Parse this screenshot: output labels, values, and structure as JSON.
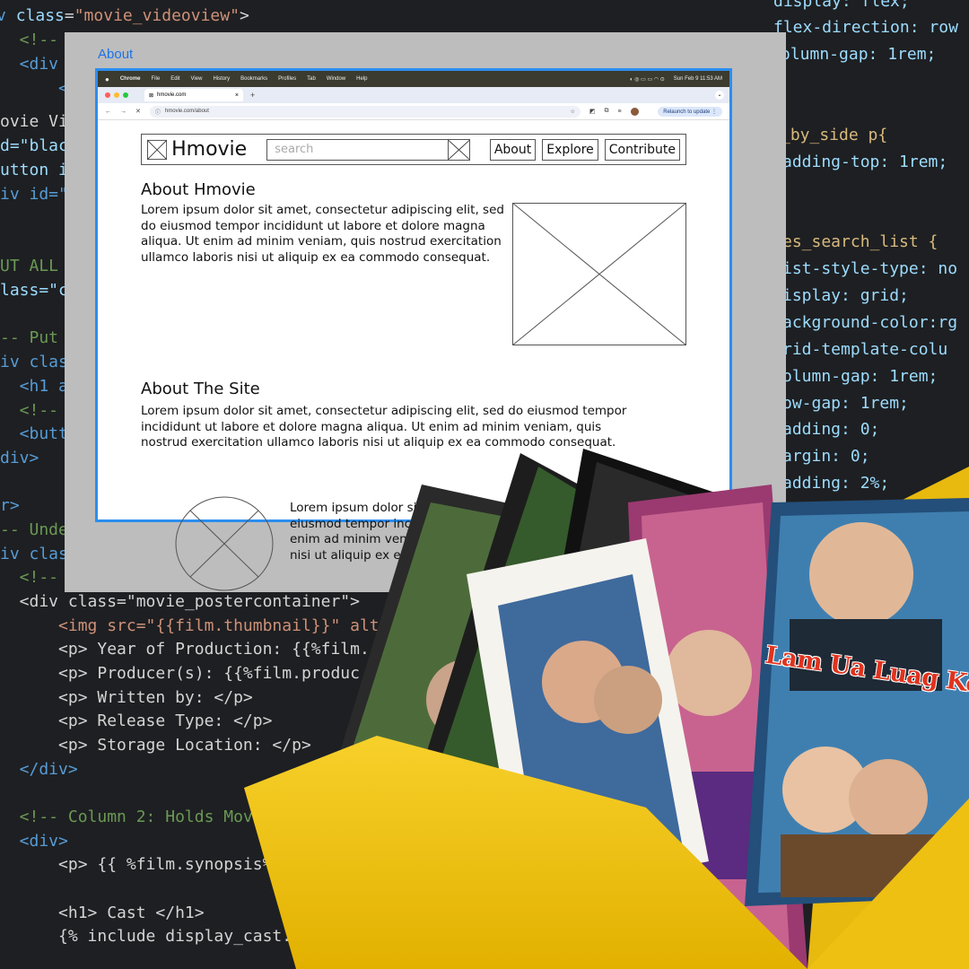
{
  "code_left": {
    "lines": [
      [
        "",
        "v ",
        "class=",
        "\"movie_videoview\"",
        ">"
      ],
      [
        "c",
        "  <!-- Co"
      ],
      [
        "",
        "  <div cl"
      ],
      [
        "",
        "      <in"
      ],
      [
        "",
        "ovie Vi"
      ],
      [
        "",
        "d=\"blac"
      ],
      [
        "",
        "utton i"
      ],
      [
        "",
        "iv id=\""
      ],
      [
        "",
        ""
      ],
      [
        "c",
        "UT ALL"
      ],
      [
        "",
        "lass=\"c"
      ],
      [
        "",
        ""
      ],
      [
        "c",
        "-- Put"
      ],
      [
        "",
        "iv clas"
      ],
      [
        "",
        "  <h1 a"
      ],
      [
        "c",
        "  <!--"
      ],
      [
        "",
        "  <butt"
      ],
      [
        "",
        "div>"
      ],
      [
        "",
        ""
      ],
      [
        "",
        "r>"
      ],
      [
        "c",
        "-- Unde"
      ],
      [
        "",
        "iv clas"
      ],
      [
        "c",
        "  <!--"
      ]
    ],
    "tail": [
      "  <div class=\"movie_postercontainer\">",
      "      <img src=\"{{film.thumbnail}}\" alt",
      "      <p> Year of Production: {{%film.",
      "      <p> Producer(s): {{%film.produc",
      "      <p> Written by: </p>",
      "      <p> Release Type: </p>",
      "      <p> Storage Location: </p>",
      "  </div>",
      "",
      "  <!-- Column 2: Holds Movi",
      "  <div>",
      "      <p> {{ %film.synopsis%}",
      "",
      "      <h1> Cast </h1>",
      "      {% include display_cast.ht"
    ]
  },
  "code_right": [
    "display: flex;",
    "flex-direction: row",
    "olumn-gap: 1rem;",
    "",
    "",
    "_by_side p{",
    "adding-top: 1rem;",
    "",
    "",
    "es_search_list {",
    "ist-style-type: no",
    "isplay: grid;",
    "ackground-color:rg",
    "rid-template-colu",
    "olumn-gap: 1rem;",
    "ow-gap: 1rem;",
    "adding: 0;",
    "argin: 0;",
    "adding: 2%;"
  ],
  "mock": {
    "label": "About",
    "menubar": {
      "app": "Chrome",
      "items": [
        "File",
        "Edit",
        "View",
        "History",
        "Bookmarks",
        "Profiles",
        "Tab",
        "Window",
        "Help"
      ],
      "datetime": "Sun Feb 9  11:53 AM"
    },
    "tab_title": "hmovie.com",
    "url": "hmovie.com/about",
    "relaunch": "Relaunch to update",
    "site": {
      "brand": "Hmovie",
      "search_placeholder": "search",
      "nav": [
        "About",
        "Explore",
        "Contribute"
      ],
      "section1_title": "About Hmovie",
      "section1_text": "Lorem ipsum dolor sit amet, consectetur adipiscing elit, sed do eiusmod tempor incididunt ut labore et dolore magna aliqua. Ut enim ad minim veniam, quis nostrud exercitation ullamco laboris nisi ut aliquip ex ea commodo consequat.",
      "section2_title": "About The Site",
      "section2_text": "Lorem ipsum dolor sit amet, consectetur adipiscing elit, sed do eiusmod tempor incididunt ut labore et dolore magna aliqua. Ut enim ad minim veniam, quis nostrud exercitation ullamco laboris nisi ut aliquip ex ea commodo consequat.",
      "section3_text": "Lorem ipsum dolor sit amet, consectetur adipiscing elit, sed do eiusmod tempor incididunt ut labore et dolore magna aliqua. Ut enim ad minim veniam, quis nostrud exercitation ullamco laboris nisi ut aliquip ex ea commodo consequat."
    }
  },
  "poster": {
    "headline": "Lam Ua Luag Kom Dhau"
  },
  "colors": {
    "code_bg": "#1e1f22",
    "panel_gray": "#bdbdbd",
    "frame_blue": "#2b8ef0",
    "envelope_yellow": "#f2c619",
    "poster_title_red": "#e0331e"
  }
}
